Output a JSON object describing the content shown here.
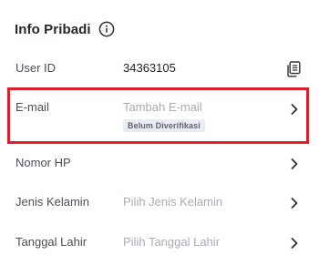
{
  "header": {
    "title": "Info Pribadi",
    "info_icon": "info-circle-icon"
  },
  "rows": {
    "user_id": {
      "label": "User ID",
      "value": "34363105",
      "icon": "copy-icon"
    },
    "email": {
      "label": "E-mail",
      "placeholder": "Tambah E-mail",
      "badge": "Belum Diverifikasi",
      "highlight_color": "#e01e2b"
    },
    "phone": {
      "label": "Nomor HP"
    },
    "gender": {
      "label": "Jenis Kelamin",
      "placeholder": "Pilih Jenis Kelamin"
    },
    "birthdate": {
      "label": "Tanggal Lahir",
      "placeholder": "Pilih Tanggal Lahir"
    }
  }
}
